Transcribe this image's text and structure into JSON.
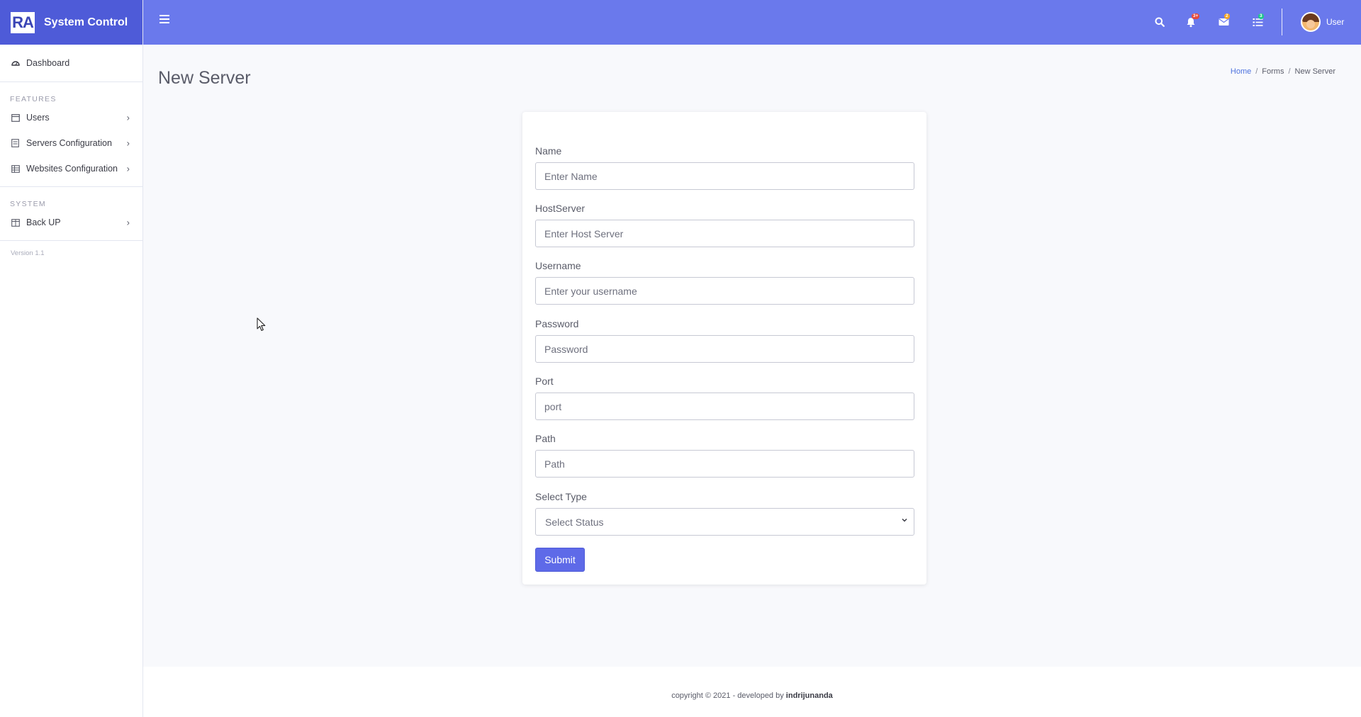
{
  "brand": {
    "logo": "RA",
    "name": "System Control"
  },
  "sidebar": {
    "dashboard": "Dashboard",
    "features_heading": "FEATURES",
    "items": [
      {
        "label": "Users",
        "icon": "window-icon"
      },
      {
        "label": "Servers Configuration",
        "icon": "server-icon"
      },
      {
        "label": "Websites Configuration",
        "icon": "table-icon"
      }
    ],
    "system_heading": "SYSTEM",
    "system_items": [
      {
        "label": "Back UP",
        "icon": "columns-icon"
      }
    ],
    "version": "Version 1.1"
  },
  "topbar": {
    "notifications_badge": "3+",
    "messages_badge": "2",
    "tasks_badge": "3",
    "user_label": "User",
    "colors": {
      "topbar": "#6a79ec",
      "brand": "#4e5bd8",
      "badge_red": "#e74a3b",
      "badge_orange": "#f6a623",
      "badge_green": "#1cc88a"
    }
  },
  "page": {
    "title": "New Server",
    "breadcrumb": {
      "home": "Home",
      "forms": "Forms",
      "current": "New Server"
    }
  },
  "form": {
    "name": {
      "label": "Name",
      "placeholder": "Enter Name"
    },
    "host": {
      "label": "HostServer",
      "placeholder": "Enter Host Server"
    },
    "username": {
      "label": "Username",
      "placeholder": "Enter your username"
    },
    "password": {
      "label": "Password",
      "placeholder": "Password"
    },
    "port": {
      "label": "Port",
      "placeholder": "port"
    },
    "path": {
      "label": "Path",
      "placeholder": "Path"
    },
    "type": {
      "label": "Select Type",
      "selected": "Select Status"
    },
    "submit": "Submit"
  },
  "footer": {
    "text": "copyright © 2021 - developed by",
    "author": "indrijunanda"
  }
}
